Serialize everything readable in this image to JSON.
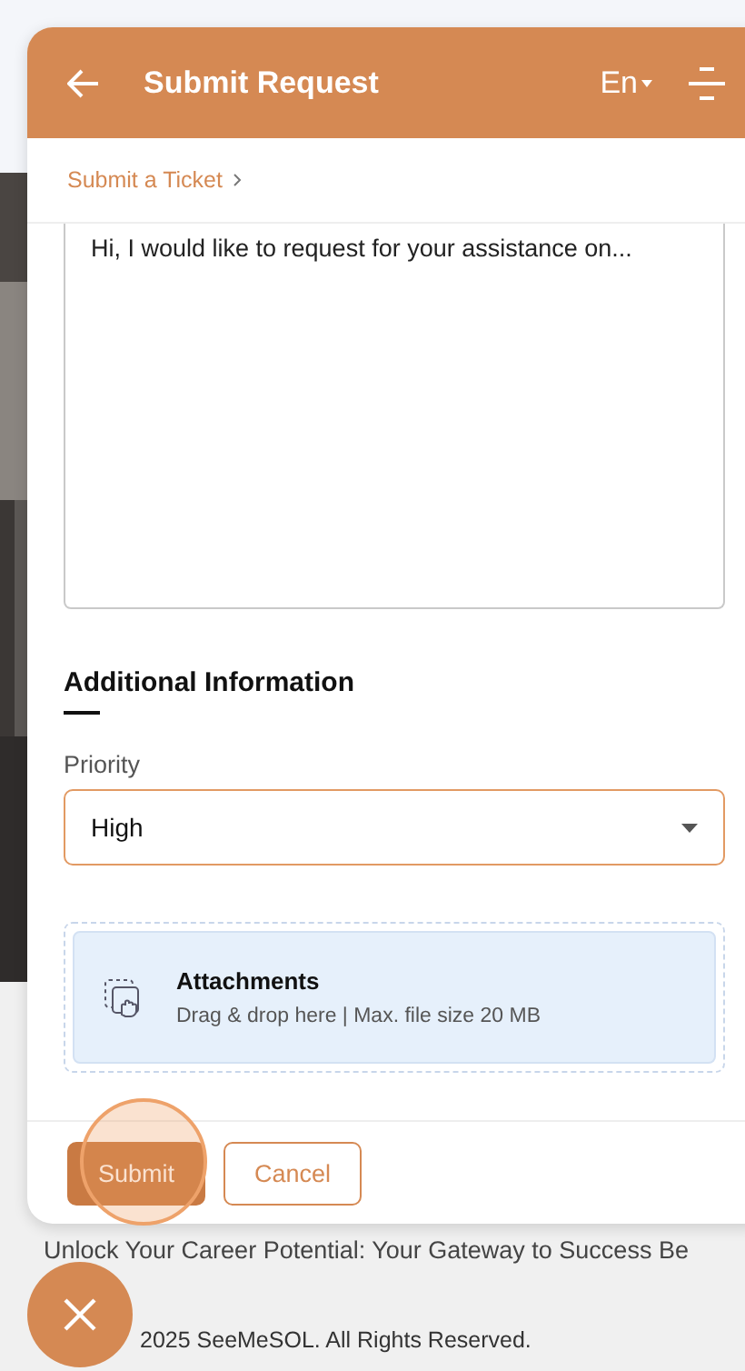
{
  "header": {
    "title": "Submit Request",
    "language": "En"
  },
  "breadcrumb": [
    "Submit a Ticket"
  ],
  "message": {
    "value": "Hi, I would like to request for your assistance on..."
  },
  "section": {
    "heading": "Additional Information"
  },
  "priority": {
    "label": "Priority",
    "value": "High"
  },
  "attachments": {
    "title": "Attachments",
    "hint": "Drag & drop here | Max. file size 20 MB"
  },
  "buttons": [
    {
      "label": "Submit",
      "kind": "primary",
      "pressed": true
    },
    {
      "label": "Cancel",
      "kind": "secondary",
      "pressed": false
    }
  ],
  "page": {
    "tagline": "Unlock Your Career Potential: Your Gateway to Success Be",
    "copyright": "2025 SeeMeSOL. All Rights Reserved."
  }
}
